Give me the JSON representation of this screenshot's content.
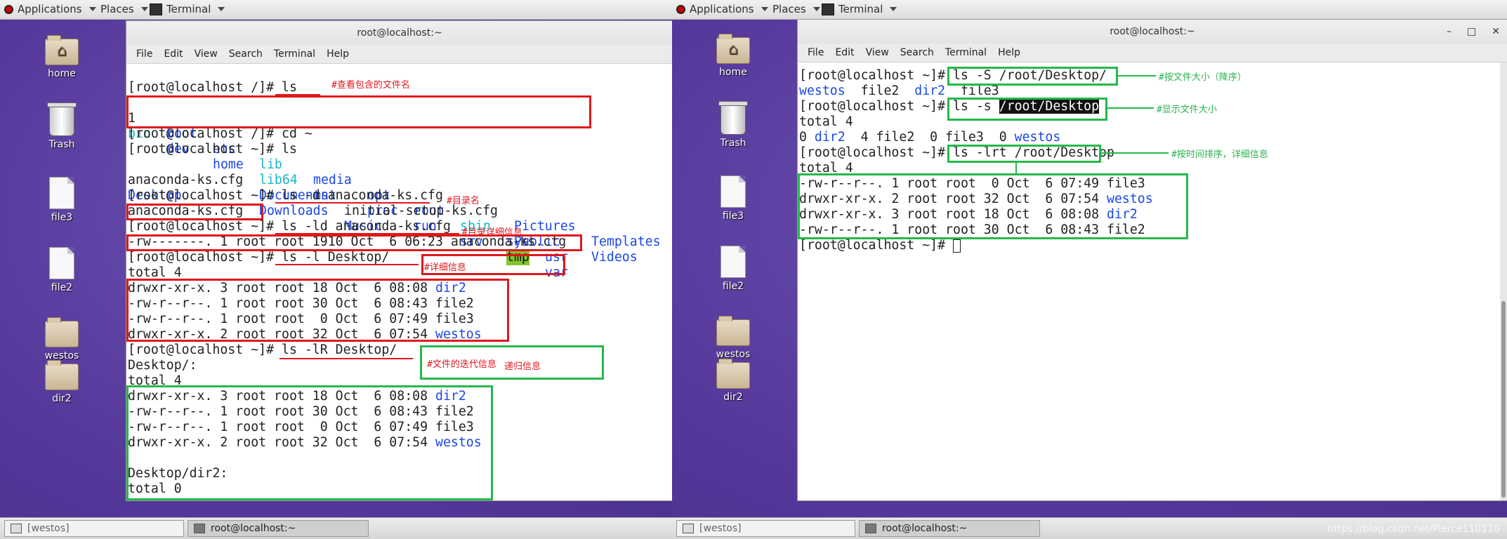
{
  "topbar": {
    "applications": "Applications",
    "places": "Places",
    "terminal": "Terminal"
  },
  "desktop_icons": [
    {
      "label": "home"
    },
    {
      "label": "Trash"
    },
    {
      "label": "file3"
    },
    {
      "label": "file2"
    },
    {
      "label": "westos"
    },
    {
      "label": "dir2"
    }
  ],
  "window": {
    "title": "root@localhost:~",
    "menu": [
      "File",
      "Edit",
      "View",
      "Search",
      "Terminal",
      "Help"
    ]
  },
  "left_terminal": {
    "prompt_root": "[root@localhost /]#",
    "prompt_home": "[root@localhost ~]#",
    "cmd_ls": "ls",
    "ls_root_row1": [
      "1",
      "boot",
      "etc",
      "lib",
      "media",
      "opt",
      "root",
      "sbin",
      "sys",
      "usr"
    ],
    "ls_root_row2": [
      "bin",
      "dev",
      "home",
      "lib64",
      "mnt",
      "proc",
      "run",
      "srv",
      "tmp",
      "var"
    ],
    "cmd_cd": "cd ~",
    "cmd_ls2": "ls",
    "home_row1": [
      "anaconda-ks.cfg",
      "Documents",
      "initial-setup-ks.cfg",
      "Pictures",
      "Templates"
    ],
    "home_row2": [
      "Desktop",
      "Downloads",
      "Music",
      "Public",
      "Videos"
    ],
    "cmd_ls_d": "ls -d anaconda-ks.cfg",
    "out_ls_d": "anaconda-ks.cfg",
    "cmd_ls_ld": "ls -ld anaconda-ks.cfg",
    "out_ls_ld": "-rw-------. 1 root root 1910 Oct  6 06:23 anaconda-ks.cfg",
    "cmd_ls_l": "ls -l Desktop/",
    "total4": "total 4",
    "listing": [
      {
        "meta": "drwxr-xr-x. 3 root root 18 Oct  6 08:08 ",
        "name": "dir2",
        "dir": true
      },
      {
        "meta": "-rw-r--r--. 1 root root 30 Oct  6 08:43 ",
        "name": "file2",
        "dir": false
      },
      {
        "meta": "-rw-r--r--. 1 root root  0 Oct  6 07:49 ",
        "name": "file3",
        "dir": false
      },
      {
        "meta": "drwxr-xr-x. 2 root root 32 Oct  6 07:54 ",
        "name": "westos",
        "dir": true
      }
    ],
    "cmd_ls_lR": "ls -lR Desktop/",
    "desktop_heading": "Desktop/:",
    "total4b": "total 4",
    "listing2": [
      {
        "meta": "drwxr-xr-x. 3 root root 18 Oct  6 08:08 ",
        "name": "dir2",
        "dir": true
      },
      {
        "meta": "-rw-r--r--. 1 root root 30 Oct  6 08:43 ",
        "name": "file2",
        "dir": false
      },
      {
        "meta": "-rw-r--r--. 1 root root  0 Oct  6 07:49 ",
        "name": "file3",
        "dir": false
      },
      {
        "meta": "drwxr-xr-x. 2 root root 32 Oct  6 07:54 ",
        "name": "westos",
        "dir": true
      }
    ],
    "dir2_heading": "Desktop/dir2:",
    "total0": "total 0",
    "annotations": {
      "a1": "#查看包含的文件名",
      "a2": "#目录名",
      "a3": "#目录详细信息",
      "a4": "#详细信息",
      "a5": "#文件的迭代信息",
      "a6": "递归信息"
    }
  },
  "right_terminal": {
    "prompt_home": "[root@localhost ~]#",
    "cmd_S": "ls -S /root/Desktop/",
    "out_S": [
      {
        "name": "westos",
        "dir": true
      },
      {
        "name": "file2",
        "dir": false
      },
      {
        "name": "dir2",
        "dir": true
      },
      {
        "name": "file3",
        "dir": false
      }
    ],
    "cmd_s_pre": "ls -s ",
    "cmd_s_sel": "/root/Desktop",
    "total4": "total 4",
    "out_s": [
      {
        "text": "0 ",
        "dir": false
      },
      {
        "text": "dir2",
        "dir": true
      },
      {
        "text": "  4 file2  0 file3  0 ",
        "dir": false
      },
      {
        "text": "westos",
        "dir": true
      }
    ],
    "cmd_lrt": "ls -lrt /root/Desktop",
    "total4b": "total 4",
    "listing": [
      {
        "meta": "-rw-r--r--. 1 root root  0 Oct  6 07:49 ",
        "name": "file3",
        "dir": false
      },
      {
        "meta": "drwxr-xr-x. 2 root root 32 Oct  6 07:54 ",
        "name": "westos",
        "dir": true
      },
      {
        "meta": "drwxr-xr-x. 3 root root 18 Oct  6 08:08 ",
        "name": "dir2",
        "dir": true
      },
      {
        "meta": "-rw-r--r--. 1 root root 30 Oct  6 08:43 ",
        "name": "file2",
        "dir": false
      }
    ],
    "annotations": {
      "a1": "#按文件大小（降序）",
      "a2": "#显示文件大小",
      "a3": "#按时间排序，详细信息"
    }
  },
  "taskbar": {
    "item1": "[westos]",
    "item2": "root@localhost:~",
    "watermark": "https://blog.csdn.net/Pierce110110"
  },
  "colors": {
    "accent_red": "#e0181d",
    "accent_green": "#26b84a",
    "dir_blue": "#1a47e6",
    "link_cyan": "#17b7c9"
  }
}
